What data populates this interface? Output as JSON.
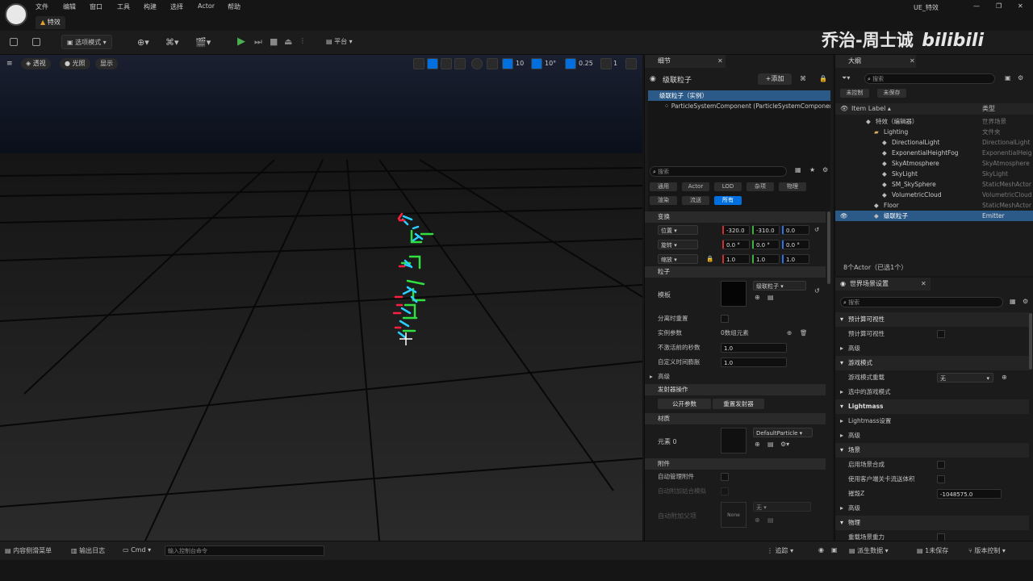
{
  "app": {
    "window_title": "UE_特效",
    "tab_title": "特效"
  },
  "menu": [
    "文件",
    "编辑",
    "窗口",
    "工具",
    "构建",
    "选择",
    "Actor",
    "帮助"
  ],
  "watermark": {
    "author": "乔治-周士诚",
    "site": "bilibili"
  },
  "toolbar": {
    "mode_label": "选项模式",
    "platform_label": "平台"
  },
  "viewport": {
    "perspective_label": "透视",
    "lit_label": "光照",
    "show_label": "显示",
    "grid_value": "10",
    "angle_value": "10°",
    "scale_value": "0.25",
    "camera_speed": "1"
  },
  "details": {
    "tab_title": "细节",
    "object_name": "级联粒子",
    "add_label": "+添加",
    "tree": [
      "级联粒子（实例）",
      "ParticleSystemComponent (ParticleSystemComponent)"
    ],
    "search_placeholder": "搜索",
    "categories_row1": [
      "通用",
      "Actor",
      "LOD",
      "杂项",
      "物理"
    ],
    "categories_row2": [
      "渲染",
      "流送",
      "所有"
    ],
    "transform": {
      "section": "变换",
      "location_label": "位置",
      "rotation_label": "旋转",
      "scale_label": "缩放",
      "location": [
        "-320.0",
        "-310.0",
        "0.0"
      ],
      "rotation": [
        "0.0 °",
        "0.0 °",
        "0.0 °"
      ],
      "scale": [
        "1.0",
        "1.0",
        "1.0"
      ]
    },
    "particles": {
      "section": "粒子",
      "template_label": "模板",
      "template_value": "级联粒子",
      "reset_on_detach_label": "分离时重置",
      "instance_params_label": "实例参数",
      "instance_params_value": "0数组元素",
      "seconds_before_inactive_label": "不激活前的秒数",
      "seconds_before_inactive_value": "1.0",
      "custom_time_dilation_label": "自定义时间膨胀",
      "custom_time_dilation_value": "1.0",
      "advanced_label": "高级"
    },
    "emitter_actions": {
      "section": "发射器操作",
      "expose_params": "公开参数",
      "reset_emitter": "重置发射器"
    },
    "materials": {
      "section": "材质",
      "element_label": "元素 0",
      "element_value": "DefaultParticle"
    },
    "attachment": {
      "section": "附件",
      "auto_manage_label": "自动管理附件",
      "auto_attach_label": "自动附加姑合模拟",
      "auto_attach_parent_label": "自动附加父项",
      "parent_value": "无",
      "none_thumb": "None"
    }
  },
  "outliner": {
    "tab_title": "大纲",
    "search_placeholder": "搜索",
    "filter_unmanaged": "未控制",
    "filter_unsaved": "未保存",
    "col_label": "Item Label ▴",
    "col_type": "类型",
    "rows": [
      {
        "label": "特效（编辑器）",
        "type": "世界场景",
        "indent": 0
      },
      {
        "label": "Lighting",
        "type": "文件夹",
        "indent": 1
      },
      {
        "label": "DirectionalLight",
        "type": "DirectionalLight",
        "indent": 2
      },
      {
        "label": "ExponentialHeightFog",
        "type": "ExponentialHeightFog",
        "indent": 2
      },
      {
        "label": "SkyAtmosphere",
        "type": "SkyAtmosphere",
        "indent": 2
      },
      {
        "label": "SkyLight",
        "type": "SkyLight",
        "indent": 2
      },
      {
        "label": "SM_SkySphere",
        "type": "StaticMeshActor",
        "indent": 2
      },
      {
        "label": "VolumetricCloud",
        "type": "VolumetricCloud",
        "indent": 2
      },
      {
        "label": "Floor",
        "type": "StaticMeshActor",
        "indent": 1
      },
      {
        "label": "级联粒子",
        "type": "Emitter",
        "indent": 1
      }
    ],
    "footer": "8个Actor（已选1个）"
  },
  "world_settings": {
    "tab_title": "世界场景设置",
    "search_placeholder": "搜索",
    "rows": [
      {
        "kind": "section",
        "label": "预计算可视性"
      },
      {
        "kind": "check",
        "label": "预计算可视性"
      },
      {
        "kind": "collapsed",
        "label": "高级"
      },
      {
        "kind": "section",
        "label": "游戏模式"
      },
      {
        "kind": "dropdown",
        "label": "游戏模式重载",
        "value": "无"
      },
      {
        "kind": "collapsed",
        "label": "选中的游戏模式"
      },
      {
        "kind": "section",
        "label": "Lightmass"
      },
      {
        "kind": "collapsed",
        "label": "Lightmass设置"
      },
      {
        "kind": "collapsed",
        "label": "高级"
      },
      {
        "kind": "section",
        "label": "场景"
      },
      {
        "kind": "check",
        "label": "启用场景合成"
      },
      {
        "kind": "check",
        "label": "使用客户端关卡流送体积"
      },
      {
        "kind": "field",
        "label": "摧毁Z",
        "value": "-1048575.0"
      },
      {
        "kind": "collapsed",
        "label": "高级"
      },
      {
        "kind": "section",
        "label": "物理"
      },
      {
        "kind": "check",
        "label": "重载场景重力"
      }
    ]
  },
  "status": {
    "content_drawer": "内容侧滑菜单",
    "output_log": "输出日志",
    "cmd": "Cmd",
    "cmd_placeholder": "输入控制台命令",
    "trace": "追踪",
    "derived_data": "派生数据",
    "unsaved": "1未保存",
    "source_control": "版本控制"
  },
  "colors": {
    "accent": "#0070e0",
    "selected_row": "#2c5a88",
    "play_green": "#4caf50"
  }
}
